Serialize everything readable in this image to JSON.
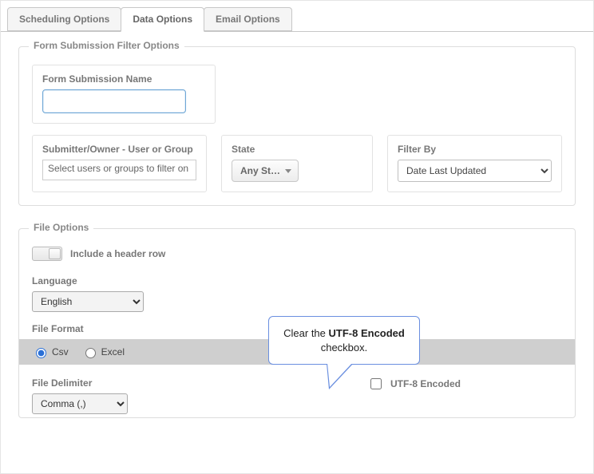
{
  "tabs": {
    "scheduling": "Scheduling Options",
    "data": "Data Options",
    "email": "Email Options"
  },
  "filter_group": {
    "legend": "Form Submission Filter Options",
    "name_label": "Form Submission Name",
    "name_value": "",
    "submitter_label": "Submitter/Owner - User or Group",
    "submitter_placeholder": "Select users or groups to filter on",
    "state_label": "State",
    "state_value": "Any St…",
    "filterby_label": "Filter By",
    "filterby_value": "Date Last Updated"
  },
  "file_group": {
    "legend": "File Options",
    "include_header_label": "Include a header row",
    "language_label": "Language",
    "language_value": "English",
    "file_format_label": "File Format",
    "format_csv": "Csv",
    "format_excel": "Excel",
    "file_delimiter_label": "File Delimiter",
    "file_delimiter_value": "Comma (,)",
    "utf8_label": "UTF-8 Encoded"
  },
  "callout": {
    "pre": "Clear the ",
    "bold": "UTF-8 Encoded",
    "post": " checkbox."
  }
}
